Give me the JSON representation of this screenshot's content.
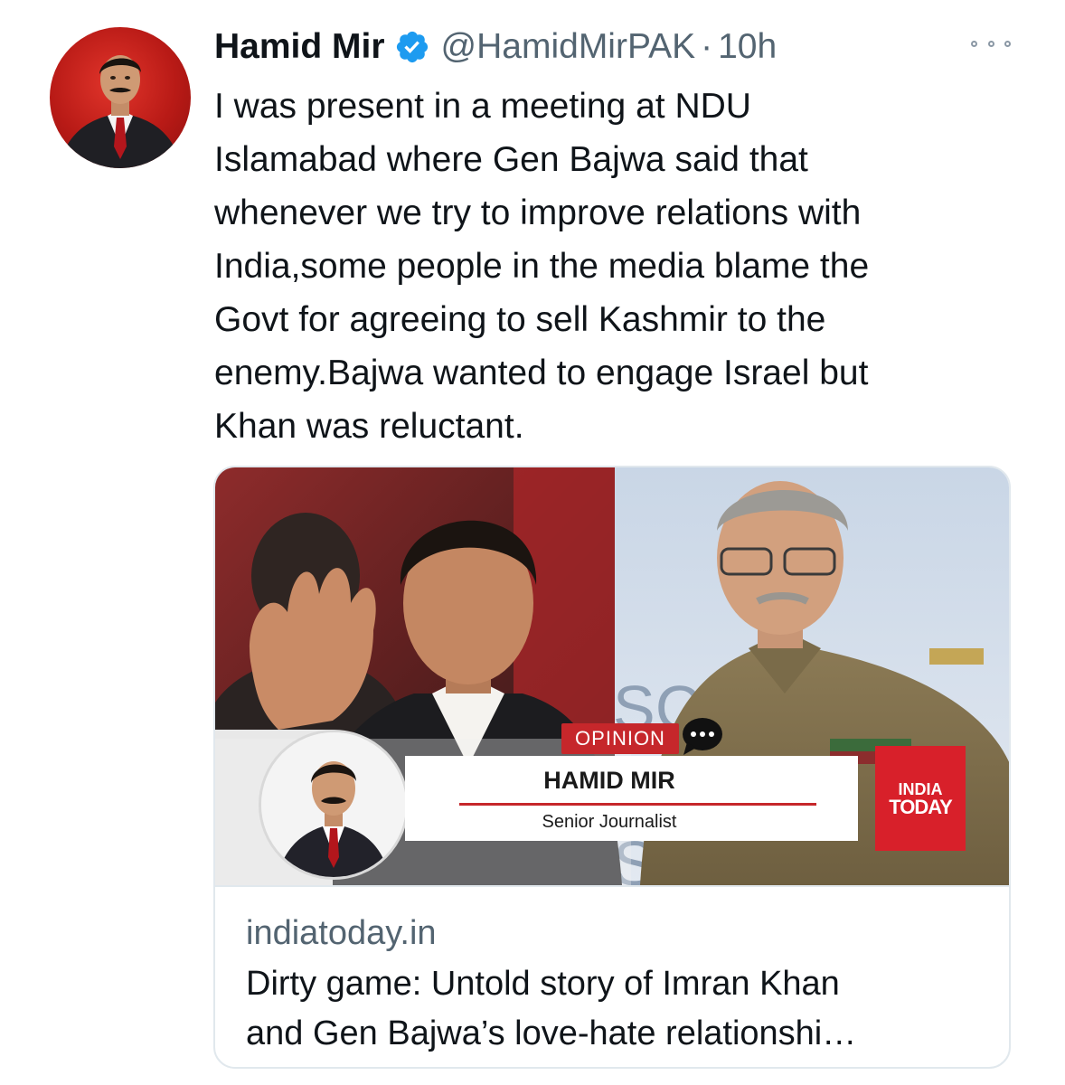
{
  "tweet": {
    "author": {
      "display_name": "Hamid Mir",
      "handle": "@HamidMirPAK",
      "separator": "·",
      "time": "10h",
      "verified": true
    },
    "text_lines": [
      "I was present in a meeting at NDU",
      "Islamabad where Gen Bajwa said that",
      "whenever we try to improve relations with",
      "India,some people in the media blame the",
      "Govt for agreeing to sell Kashmir to the",
      "enemy.Bajwa wanted to engage Israel but",
      "Khan was reluctant."
    ],
    "more_icon": "more-horizontal-icon"
  },
  "card": {
    "domain": "indiatoday.in",
    "title_lines": [
      "Dirty game: Untold story of Imran Khan",
      "and Gen Bajwa’s love-hate relationshi…"
    ],
    "image": {
      "opinion_label": "OPINION",
      "author_name": "HAMID MIR",
      "author_title": "Senior Journalist",
      "brand_line1": "INDIA",
      "brand_line2": "TODAY",
      "backdrop_letters": [
        "SC",
        "S"
      ]
    }
  },
  "colors": {
    "verified_blue": "#1d9bf0",
    "secondary_text": "#536471",
    "primary_text": "#0f1419",
    "card_border": "#e1e8ed",
    "brand_red": "#d8202a",
    "opinion_red": "#c6272b",
    "avatar_red": "#c61f19"
  }
}
